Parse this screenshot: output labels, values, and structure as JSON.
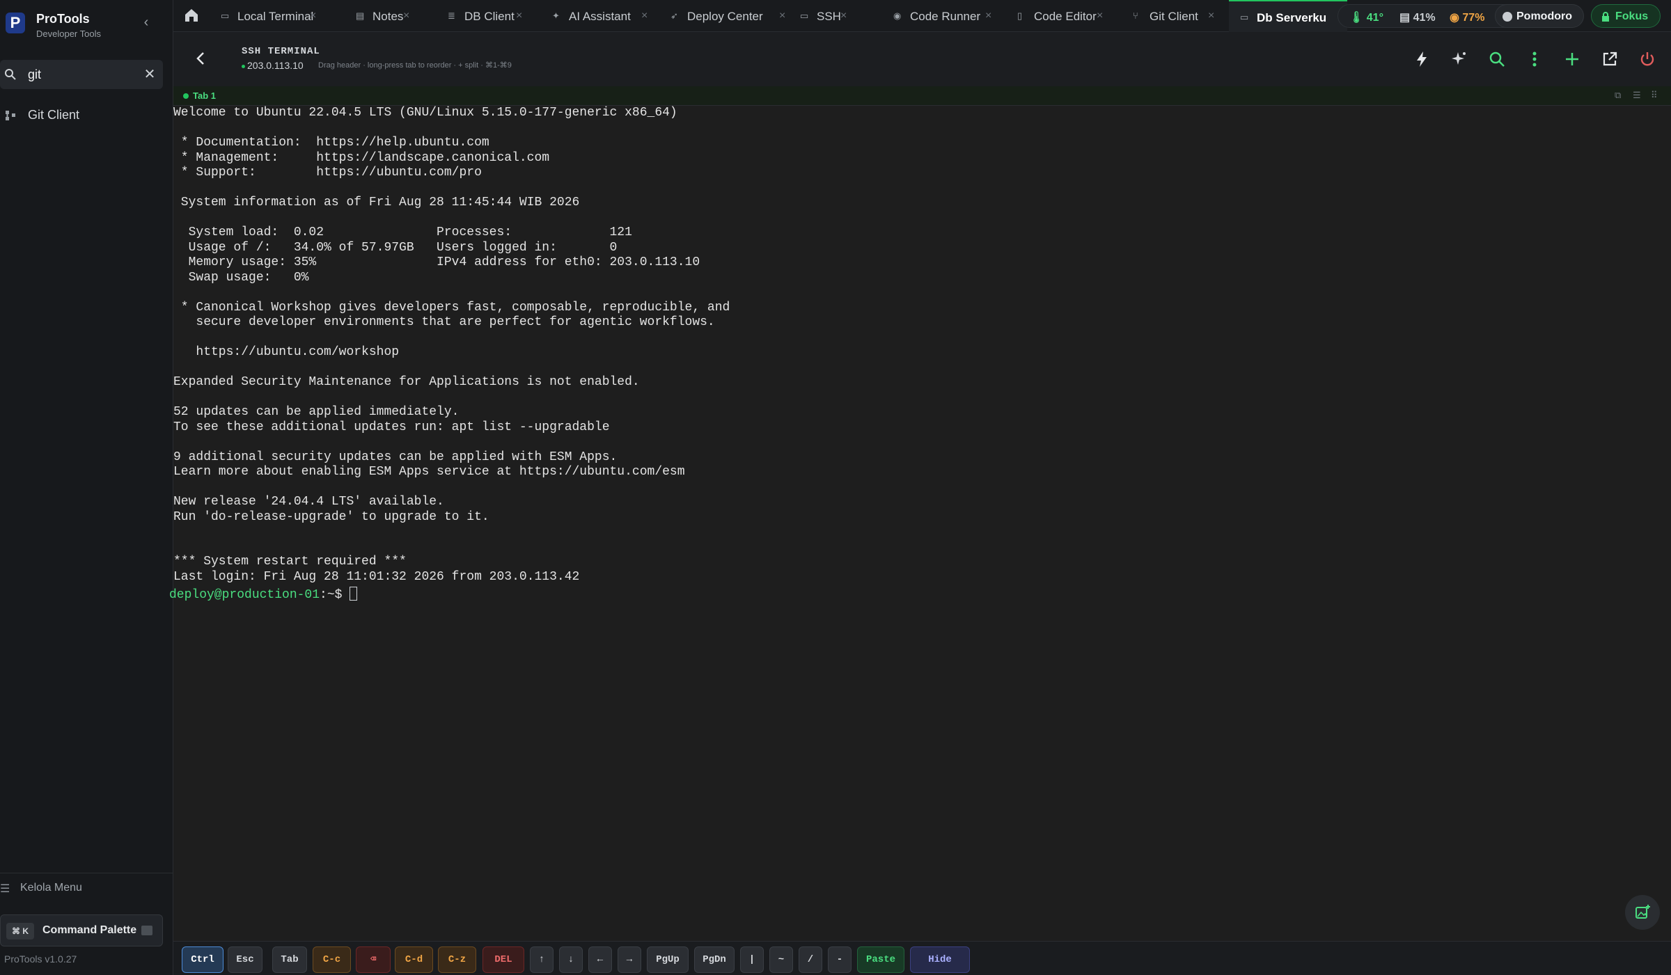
{
  "sidebar": {
    "brand_name": "ProTools",
    "brand_sub": "Developer Tools",
    "logo_letter": "P",
    "search_value": "git",
    "results": [
      {
        "label": "Git Client"
      }
    ],
    "menu_label": "Kelola Menu",
    "palette_kbd": "⌘ K",
    "palette_label": "Command Palette",
    "version": "ProTools v1.0.27"
  },
  "tabs": [
    {
      "label": "Local Terminal",
      "icon": "terminal-icon"
    },
    {
      "label": "Notes",
      "icon": "notes-icon"
    },
    {
      "label": "DB Client",
      "icon": "database-icon"
    },
    {
      "label": "AI Assistant",
      "icon": "sparkle-icon"
    },
    {
      "label": "Deploy Center",
      "icon": "rocket-icon"
    },
    {
      "label": "SSH",
      "icon": "ssh-icon"
    },
    {
      "label": "Code Runner",
      "icon": "play-icon"
    },
    {
      "label": "Code Editor",
      "icon": "file-icon"
    },
    {
      "label": "Git Client",
      "icon": "git-icon"
    },
    {
      "label": "Db Serverku",
      "icon": "server-icon",
      "active": true
    }
  ],
  "status": {
    "temp": "41°",
    "cpu": "41%",
    "battery": "77%",
    "pomodoro": "Pomodoro",
    "focus": "Fokus"
  },
  "terminal_header": {
    "title": "SSH TERMINAL",
    "host": "203.0.113.10",
    "hint": "Drag header · long-press tab to reorder · + split · ⌘1-⌘9"
  },
  "session": {
    "tab_label": "Tab 1"
  },
  "terminal": {
    "lines": [
      "Welcome to Ubuntu 22.04.5 LTS (GNU/Linux 5.15.0-177-generic x86_64)",
      "",
      " * Documentation:  https://help.ubuntu.com",
      " * Management:     https://landscape.canonical.com",
      " * Support:        https://ubuntu.com/pro",
      "",
      " System information as of Fri Aug 28 11:45:44 WIB 2026",
      "",
      "  System load:  0.02               Processes:             121",
      "  Usage of /:   34.0% of 57.97GB   Users logged in:       0",
      "  Memory usage: 35%                IPv4 address for eth0: 203.0.113.10",
      "  Swap usage:   0%",
      "",
      " * Canonical Workshop gives developers fast, composable, reproducible, and",
      "   secure developer environments that are perfect for agentic workflows.",
      "",
      "   https://ubuntu.com/workshop",
      "",
      "Expanded Security Maintenance for Applications is not enabled.",
      "",
      "52 updates can be applied immediately.",
      "To see these additional updates run: apt list --upgradable",
      "",
      "9 additional security updates can be applied with ESM Apps.",
      "Learn more about enabling ESM Apps service at https://ubuntu.com/esm",
      "",
      "New release '24.04.4 LTS' available.",
      "Run 'do-release-upgrade' to upgrade to it.",
      "",
      "",
      "*** System restart required ***",
      "Last login: Fri Aug 28 11:01:32 2026 from 203.0.113.42"
    ],
    "prompt_user": "deploy@production-01",
    "prompt_suffix": ":~$ "
  },
  "keys": [
    {
      "label": "Ctrl",
      "style": "sel"
    },
    {
      "label": "Esc",
      "style": ""
    },
    {
      "label": "Tab",
      "style": ""
    },
    {
      "label": "C-c",
      "style": "orange"
    },
    {
      "label": "⌫",
      "style": "red"
    },
    {
      "label": "C-d",
      "style": "orange"
    },
    {
      "label": "C-z",
      "style": "orange"
    },
    {
      "label": "DEL",
      "style": "red"
    },
    {
      "label": "↑",
      "style": ""
    },
    {
      "label": "↓",
      "style": ""
    },
    {
      "label": "←",
      "style": ""
    },
    {
      "label": "→",
      "style": ""
    },
    {
      "label": "PgUp",
      "style": ""
    },
    {
      "label": "PgDn",
      "style": ""
    },
    {
      "label": "|",
      "style": ""
    },
    {
      "label": "~",
      "style": ""
    },
    {
      "label": "/",
      "style": ""
    },
    {
      "label": "-",
      "style": ""
    },
    {
      "label": "Paste",
      "style": "green"
    },
    {
      "label": "Hide",
      "style": "purple"
    }
  ]
}
